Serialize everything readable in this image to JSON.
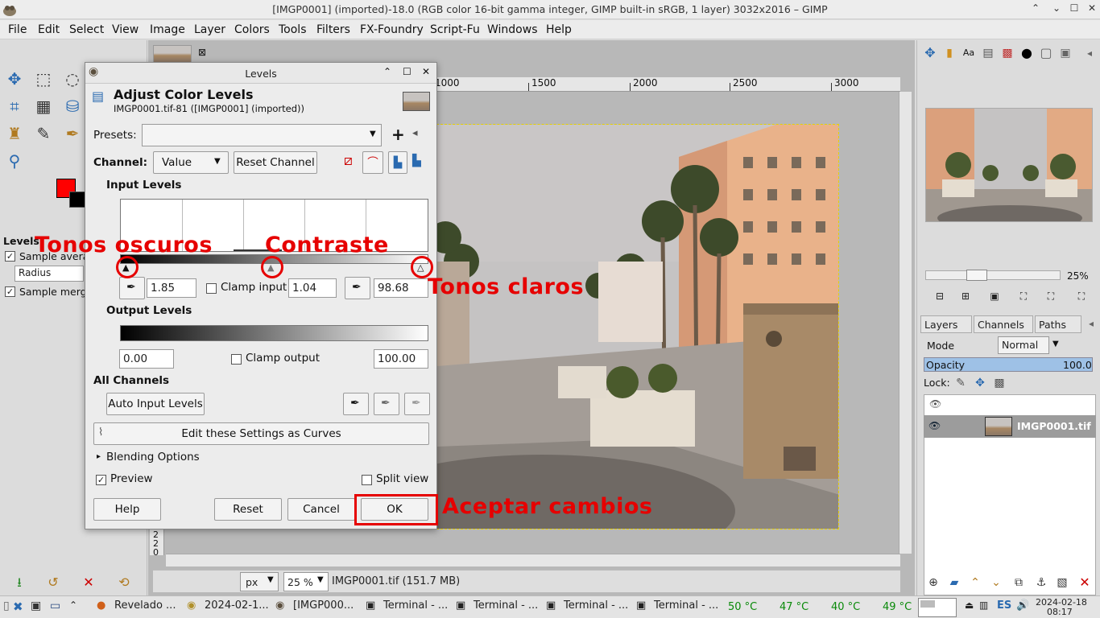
{
  "window": {
    "title": "[IMGP0001] (imported)-18.0 (RGB color 16-bit gamma integer, GIMP built-in sRGB, 1 layer) 3032x2016 – GIMP"
  },
  "menu": [
    "File",
    "Edit",
    "Select",
    "View",
    "Image",
    "Layer",
    "Colors",
    "Tools",
    "Filters",
    "FX-Foundry",
    "Script-Fu",
    "Windows",
    "Help"
  ],
  "toolbox": {
    "options_title": "Levels",
    "sample_average": "Sample average",
    "radius": "Radius",
    "sample_merged": "Sample merged",
    "fg_color": "#ff0000",
    "bg_color": "#000000"
  },
  "ruler": {
    "h_labels": [
      "1000",
      "1500",
      "2000",
      "2500",
      "3000"
    ],
    "v_labels": [
      "2",
      "2",
      "0",
      "0"
    ]
  },
  "status": {
    "unit": "px",
    "zoom": "25 %",
    "info": "IMGP0001.tif (151.7 MB)"
  },
  "dialog": {
    "title": "Levels",
    "heading": "Adjust Color Levels",
    "subheading": "IMGP0001.tif-81 ([IMGP0001] (imported))",
    "presets_label": "Presets:",
    "channel_label": "Channel:",
    "channel_value": "Value",
    "reset_channel": "Reset Channel",
    "input_levels": "Input Levels",
    "input_low": "1.85",
    "clamp_input": "Clamp input",
    "gamma": "1.04",
    "input_high": "98.68",
    "output_levels": "Output Levels",
    "output_low": "0.00",
    "clamp_output": "Clamp output",
    "output_high": "100.00",
    "all_channels": "All Channels",
    "auto_input": "Auto Input Levels",
    "edit_curves": "Edit these Settings as Curves",
    "blending": "Blending Options",
    "preview": "Preview",
    "split_view": "Split view",
    "help": "Help",
    "reset": "Reset",
    "cancel": "Cancel",
    "ok": "OK"
  },
  "annotations": {
    "dark": "Tonos oscuros",
    "contrast": "Contraste",
    "light": "Tonos claros",
    "accept": "Aceptar cambios",
    "color": "#e60000"
  },
  "dock": {
    "nav_zoom": "25%",
    "tabs": [
      "Layers",
      "Channels",
      "Paths"
    ],
    "mode_label": "Mode",
    "mode_value": "Normal",
    "opacity_label": "Opacity",
    "opacity_value": "100.0",
    "lock_label": "Lock:",
    "layer_name": "IMGP0001.tif"
  },
  "taskbar": {
    "tasks": [
      "Revelado ...",
      "2024-02-1...",
      "[IMGP000...",
      "Terminal - ...",
      "Terminal - ...",
      "Terminal - ...",
      "Terminal - ..."
    ],
    "temps": [
      "50 °C",
      "47 °C",
      "40 °C",
      "49 °C"
    ],
    "lang": "ES",
    "date": "2024-02-18",
    "time": "08:17"
  }
}
